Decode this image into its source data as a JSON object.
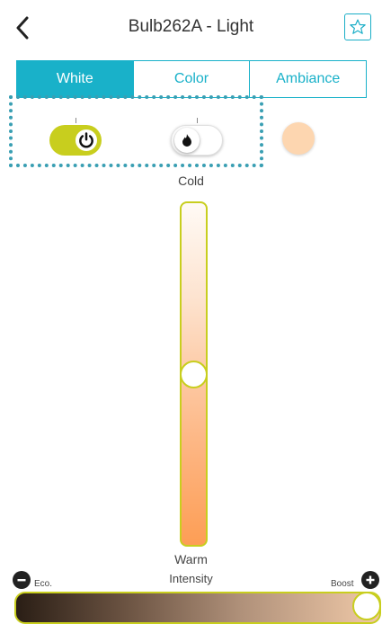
{
  "header": {
    "title": "Bulb262A - Light",
    "back_icon": "chevron-left-icon",
    "favorite_icon": "star-outline-icon"
  },
  "tabs": [
    {
      "label": "White",
      "active": true
    },
    {
      "label": "Color",
      "active": false
    },
    {
      "label": "Ambiance",
      "active": false
    }
  ],
  "controls": {
    "power": {
      "icon": "power-icon",
      "on": true
    },
    "flame": {
      "icon": "flame-icon",
      "on": false
    },
    "swatch_color": "#fdd6b0"
  },
  "temperature": {
    "top_label": "Cold",
    "bottom_label": "Warm",
    "value_fraction_from_top": 0.5
  },
  "intensity": {
    "label": "Intensity",
    "min_label": "Eco.",
    "max_label": "Boost",
    "value_fraction": 1.0
  },
  "colors": {
    "accent": "#19b1c9",
    "toggle_active": "#c8ce1e"
  }
}
